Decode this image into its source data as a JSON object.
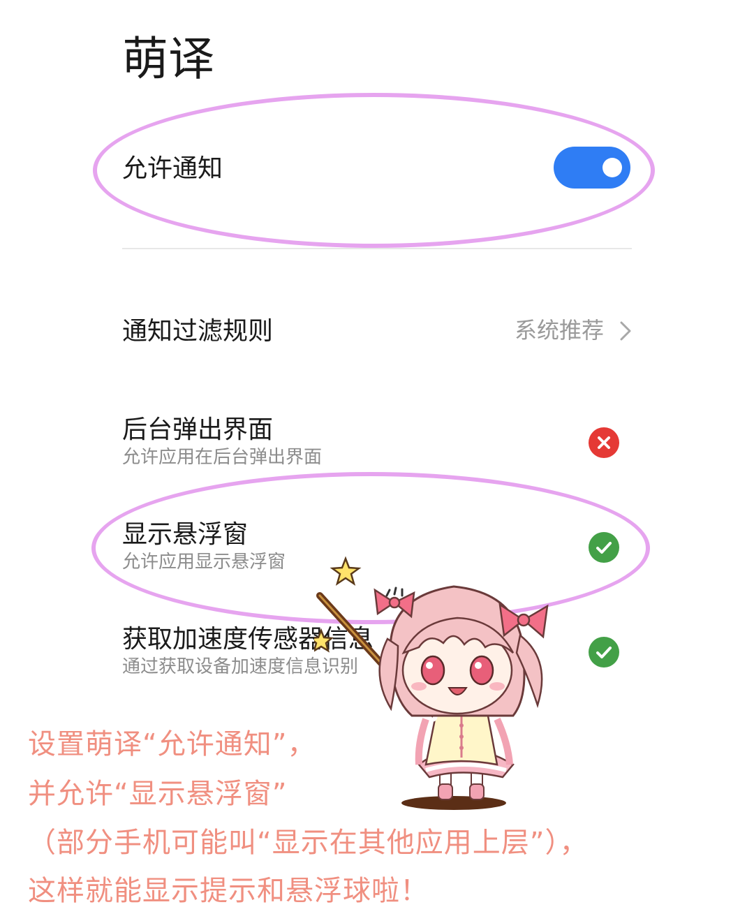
{
  "app": {
    "title": "萌译"
  },
  "allow_notification": {
    "label": "允许通知",
    "enabled": true
  },
  "filter_rule": {
    "label": "通知过滤规则",
    "value": "系统推荐"
  },
  "permissions": [
    {
      "title": "后台弹出界面",
      "subtitle": "允许应用在后台弹出界面",
      "status": "denied"
    },
    {
      "title": "显示悬浮窗",
      "subtitle": "允许应用显示悬浮窗",
      "status": "allowed"
    },
    {
      "title": "获取加速度传感器信息",
      "subtitle": "通过获取设备加速度信息识别",
      "status": "allowed"
    }
  ],
  "caption": {
    "lines": [
      "设置萌译“允许通知”，",
      "并允许“显示悬浮窗”",
      "（部分手机可能叫“显示在其他应用上层”），",
      "这样就能显示提示和悬浮球啦！"
    ]
  },
  "colors": {
    "toggle_on": "#2f7df4",
    "denied": "#e53935",
    "allowed": "#43a047",
    "highlight": "#e6a4ef",
    "caption": "#f08f80"
  },
  "icons": [
    "chevron-right-icon",
    "denied-x-icon",
    "allowed-check-icon",
    "star-icon",
    "magical-girl-mascot"
  ]
}
